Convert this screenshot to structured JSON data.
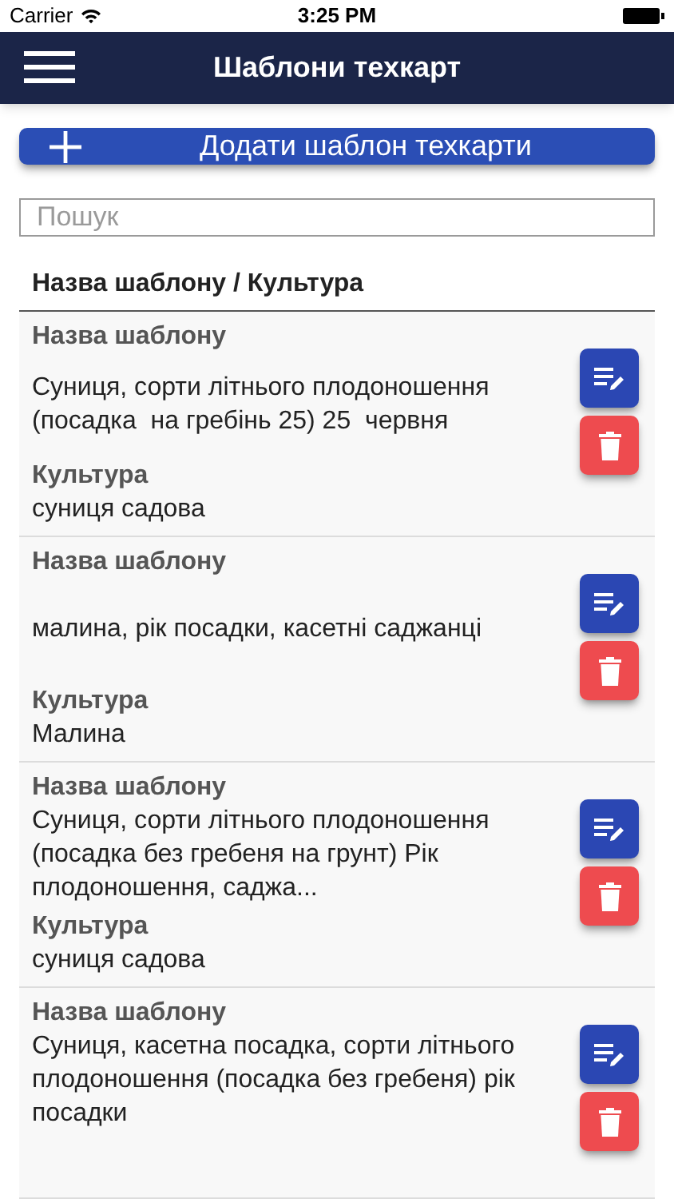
{
  "status_bar": {
    "carrier": "Carrier",
    "time": "3:25 PM"
  },
  "nav_bar": {
    "title": "Шаблони техкарт"
  },
  "add_button": {
    "label": "Додати шаблон техкарти"
  },
  "search": {
    "placeholder": "Пошук"
  },
  "list_header": "Назва шаблону / Культура",
  "templates": [
    {
      "name_label": "Назва шаблону",
      "name": "Суниця, сорти літнього плодоношення (посадка  на гребінь 25) 25  червня",
      "culture_label": "Культура",
      "culture": "суниця садова"
    },
    {
      "name_label": "Назва шаблону",
      "name": "малина, рік посадки, касетні саджанці",
      "culture_label": "Культура",
      "culture": "Малина"
    },
    {
      "name_label": "Назва шаблону",
      "name": "Суниця, сорти літнього плодоношення (посадка без гребеня на грунт) Рік плодоношення, саджа...",
      "culture_label": "Культура",
      "culture": "суниця садова"
    },
    {
      "name_label": "Назва шаблону",
      "name": "Суниця, касетна посадка, сорти літнього плодоношення (посадка без гребеня) рік посадки"
    }
  ]
}
